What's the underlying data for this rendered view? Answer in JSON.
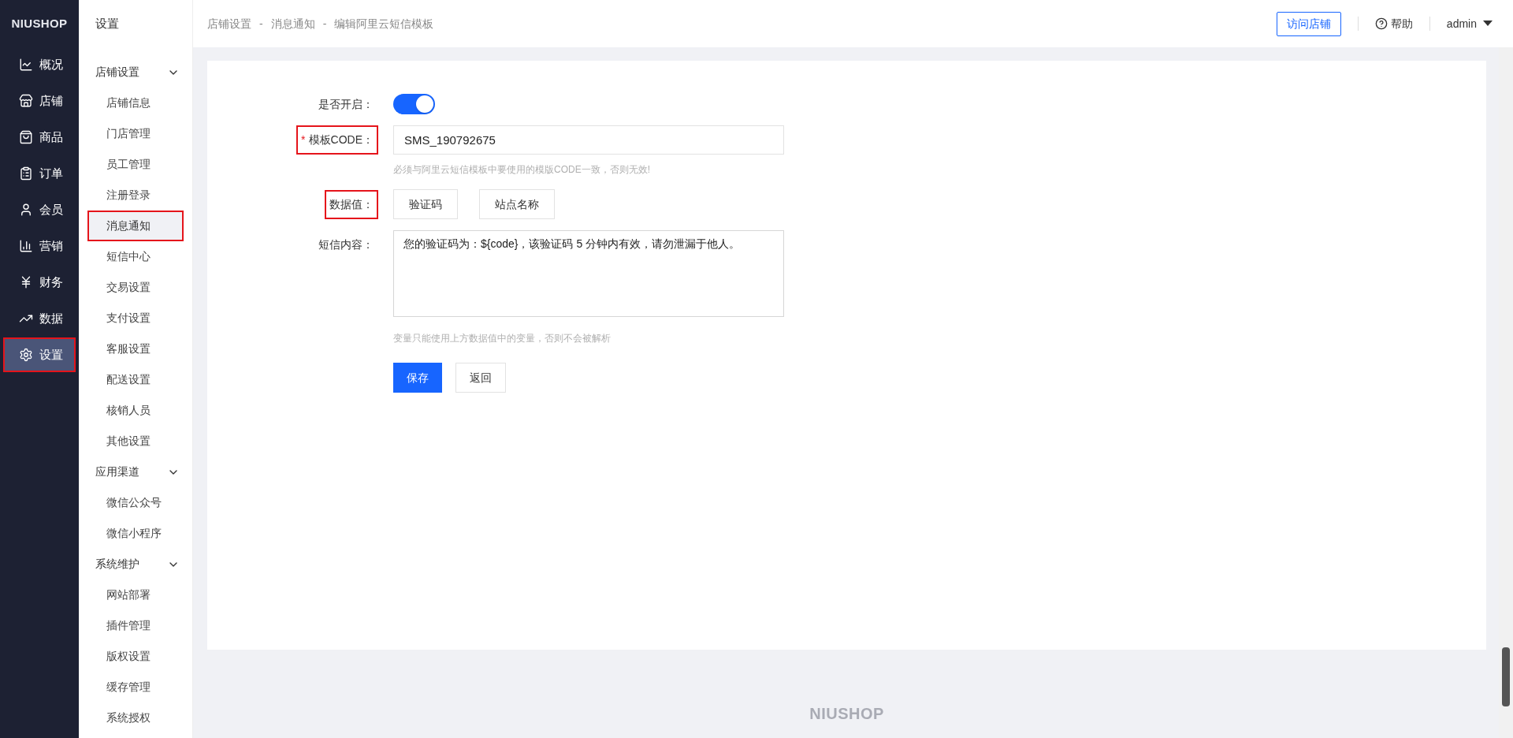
{
  "logo": "NIUSHOP",
  "nav": [
    {
      "label": "概况",
      "kind": "overview",
      "selected": false,
      "highlighted": false
    },
    {
      "label": "店铺",
      "kind": "store",
      "selected": false,
      "highlighted": false
    },
    {
      "label": "商品",
      "kind": "goods",
      "selected": false,
      "highlighted": false
    },
    {
      "label": "订单",
      "kind": "order",
      "selected": false,
      "highlighted": false
    },
    {
      "label": "会员",
      "kind": "member",
      "selected": false,
      "highlighted": false
    },
    {
      "label": "营销",
      "kind": "marketing",
      "selected": false,
      "highlighted": false
    },
    {
      "label": "财务",
      "kind": "finance",
      "selected": false,
      "highlighted": false
    },
    {
      "label": "数据",
      "kind": "data",
      "selected": false,
      "highlighted": false
    },
    {
      "label": "设置",
      "kind": "settings",
      "selected": true,
      "highlighted": true
    }
  ],
  "submenu": {
    "title": "设置",
    "groups": [
      {
        "label": "店铺设置",
        "expanded": true,
        "children": [
          {
            "label": "店铺信息",
            "selected": false,
            "highlighted": false
          },
          {
            "label": "门店管理",
            "selected": false,
            "highlighted": false
          },
          {
            "label": "员工管理",
            "selected": false,
            "highlighted": false
          },
          {
            "label": "注册登录",
            "selected": false,
            "highlighted": false
          },
          {
            "label": "消息通知",
            "selected": true,
            "highlighted": true
          },
          {
            "label": "短信中心",
            "selected": false,
            "highlighted": false
          },
          {
            "label": "交易设置",
            "selected": false,
            "highlighted": false
          },
          {
            "label": "支付设置",
            "selected": false,
            "highlighted": false
          },
          {
            "label": "客服设置",
            "selected": false,
            "highlighted": false
          },
          {
            "label": "配送设置",
            "selected": false,
            "highlighted": false
          },
          {
            "label": "核销人员",
            "selected": false,
            "highlighted": false
          },
          {
            "label": "其他设置",
            "selected": false,
            "highlighted": false
          }
        ]
      },
      {
        "label": "应用渠道",
        "expanded": true,
        "children": [
          {
            "label": "微信公众号",
            "selected": false,
            "highlighted": false
          },
          {
            "label": "微信小程序",
            "selected": false,
            "highlighted": false
          }
        ]
      },
      {
        "label": "系统维护",
        "expanded": true,
        "children": [
          {
            "label": "网站部署",
            "selected": false,
            "highlighted": false
          },
          {
            "label": "插件管理",
            "selected": false,
            "highlighted": false
          },
          {
            "label": "版权设置",
            "selected": false,
            "highlighted": false
          },
          {
            "label": "缓存管理",
            "selected": false,
            "highlighted": false
          },
          {
            "label": "系统授权",
            "selected": false,
            "highlighted": false
          }
        ]
      }
    ]
  },
  "breadcrumb": {
    "items": [
      "店铺设置",
      "消息通知",
      "编辑阿里云短信模板"
    ],
    "separators": [
      "-",
      "-"
    ]
  },
  "header": {
    "visit_store": "访问店铺",
    "help": "帮助",
    "user": "admin"
  },
  "form": {
    "enable": {
      "label": "是否开启：",
      "on": true
    },
    "code": {
      "label": "模板CODE：",
      "required_mark": "*",
      "highlighted": true,
      "value": "SMS_190792675",
      "hint": "必须与阿里云短信模板中要使用的模版CODE一致，否则无效!"
    },
    "data_values": {
      "label": "数据值：",
      "highlighted": true,
      "tags": [
        "验证码",
        "站点名称"
      ]
    },
    "content": {
      "label": "短信内容：",
      "value": "您的验证码为：${code}，该验证码 5 分钟内有效，请勿泄漏于他人。",
      "hint": "变量只能使用上方数据值中的变量，否则不会被解析"
    },
    "buttons": [
      {
        "label": "保存",
        "kind": "primary"
      },
      {
        "label": "返回",
        "kind": "default"
      }
    ]
  },
  "footer_logo": "NIUSHOP"
}
